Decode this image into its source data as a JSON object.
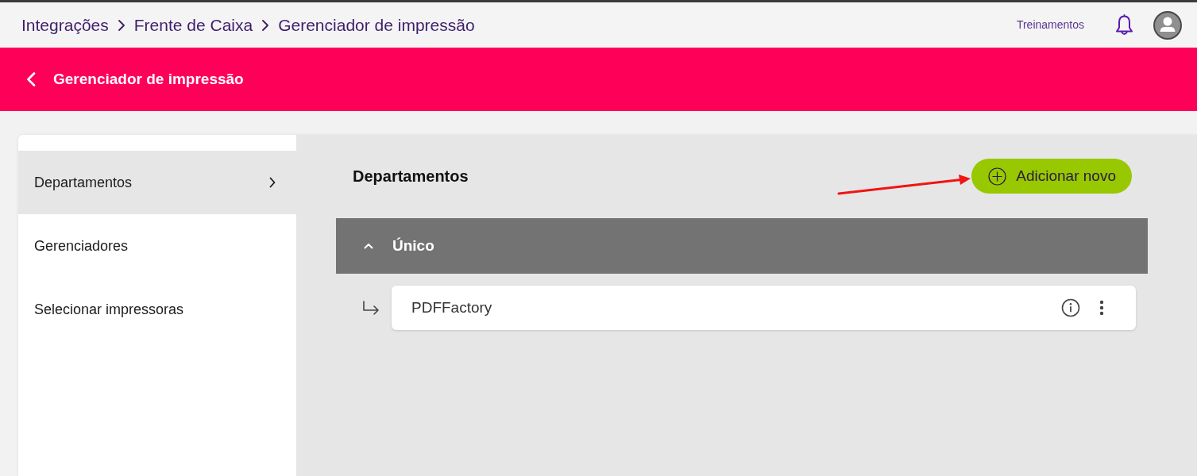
{
  "breadcrumb": [
    {
      "label": "Integrações"
    },
    {
      "label": "Frente de Caixa"
    },
    {
      "label": "Gerenciador de impressão"
    }
  ],
  "top_links": {
    "training": "Treinamentos"
  },
  "header": {
    "title": "Gerenciador de impressão"
  },
  "sidebar": {
    "items": [
      {
        "label": "Departamentos",
        "selected": true
      },
      {
        "label": "Gerenciadores",
        "selected": false
      },
      {
        "label": "Selecionar impressoras",
        "selected": false
      }
    ]
  },
  "content": {
    "title": "Departamentos",
    "add_button": "Adicionar novo",
    "groups": [
      {
        "name": "Único",
        "expanded": true,
        "children": [
          {
            "name": "PDFFactory"
          }
        ]
      }
    ]
  }
}
